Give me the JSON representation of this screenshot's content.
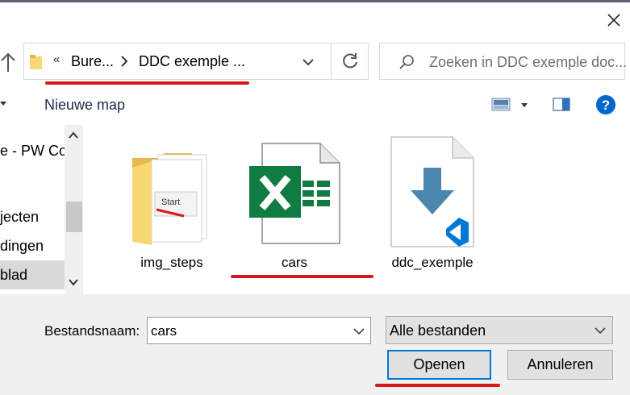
{
  "address_bar": {
    "overflow_glyph": "«",
    "crumbs": [
      "Bure...",
      "DDC exemple ..."
    ]
  },
  "search": {
    "placeholder": "Zoeken in DDC exemple doc..."
  },
  "toolbar": {
    "new_folder_label": "Nieuwe map"
  },
  "nav_pane": {
    "items": [
      {
        "label": "e - PW Co",
        "selected": false
      },
      {
        "label": "jecten",
        "selected": false
      },
      {
        "label": "dingen",
        "selected": false
      },
      {
        "label": "blad",
        "selected": true
      }
    ]
  },
  "files": [
    {
      "name": "img_steps",
      "type": "folder"
    },
    {
      "name": "cars",
      "type": "excel"
    },
    {
      "name": "ddc_exemple",
      "type": "vscode"
    }
  ],
  "footer": {
    "filename_label": "Bestandsnaam:",
    "filename_value": "cars",
    "filetype_value": "Alle bestanden",
    "open_label": "Openen",
    "cancel_label": "Annuleren"
  },
  "colors": {
    "annotation_red": "#d81818",
    "excel_green": "#107c41",
    "vscode_blue": "#0078d4",
    "focus_blue": "#0078d7"
  }
}
